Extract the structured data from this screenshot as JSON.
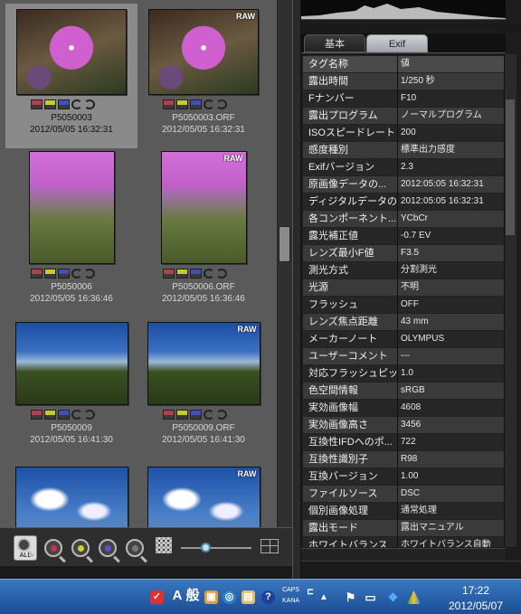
{
  "thumbnails": [
    {
      "name": "P5050003",
      "date": "2012/05/05 16:32:31",
      "raw": false,
      "selected": true,
      "art": "flower"
    },
    {
      "name": "P5050003.ORF",
      "date": "2012/05/05 16:32:31",
      "raw": true,
      "raw_label": "RAW",
      "selected": false,
      "art": "flower"
    },
    {
      "name": "P5050006",
      "date": "2012/05/05 16:36:46",
      "raw": false,
      "selected": false,
      "art": "meadow"
    },
    {
      "name": "P5050006.ORF",
      "date": "2012/05/05 16:36:46",
      "raw": true,
      "raw_label": "RAW",
      "selected": false,
      "art": "meadow"
    },
    {
      "name": "P5050009",
      "date": "2012/05/05 16:41:30",
      "raw": false,
      "selected": false,
      "art": "sky"
    },
    {
      "name": "P5050009.ORF",
      "date": "2012/05/05 16:41:30",
      "raw": true,
      "raw_label": "RAW",
      "selected": false,
      "art": "sky"
    },
    {
      "name": "",
      "date": "",
      "raw": false,
      "selected": false,
      "art": "cloud"
    },
    {
      "name": "",
      "date": "",
      "raw": true,
      "raw_label": "RAW",
      "selected": false,
      "art": "cloud"
    }
  ],
  "toolbar": {
    "zoom_all_label": "ALL"
  },
  "tabs": {
    "basic": "基本",
    "exif": "Exif"
  },
  "exif": {
    "header": {
      "key": "タグ名称",
      "value": "値"
    },
    "rows": [
      {
        "key": "露出時間",
        "value": "1/250 秒"
      },
      {
        "key": "Fナンバー",
        "value": "F10"
      },
      {
        "key": "露出プログラム",
        "value": "ノーマルプログラム"
      },
      {
        "key": "ISOスピードレート",
        "value": "200"
      },
      {
        "key": "感度種別",
        "value": "標準出力感度"
      },
      {
        "key": "Exifバージョン",
        "value": "2.3"
      },
      {
        "key": "原画像データの...",
        "value": "2012:05:05 16:32:31"
      },
      {
        "key": "ディジタルデータの...",
        "value": "2012:05:05 16:32:31"
      },
      {
        "key": "各コンポーネント...",
        "value": "YCbCr"
      },
      {
        "key": "露光補正値",
        "value": "-0.7 EV"
      },
      {
        "key": "レンズ最小F値",
        "value": "F3.5"
      },
      {
        "key": "測光方式",
        "value": "分割測光"
      },
      {
        "key": "光源",
        "value": "不明"
      },
      {
        "key": "フラッシュ",
        "value": "OFF"
      },
      {
        "key": "レンズ焦点距離",
        "value": "43 mm"
      },
      {
        "key": "メーカーノート",
        "value": "OLYMPUS"
      },
      {
        "key": "ユーザーコメント",
        "value": "---"
      },
      {
        "key": "対応フラッシュピッ...",
        "value": "1.0"
      },
      {
        "key": "色空間情報",
        "value": "sRGB"
      },
      {
        "key": "実効画像幅",
        "value": "4608"
      },
      {
        "key": "実効画像高さ",
        "value": "3456"
      },
      {
        "key": "互換性IFDへのポ...",
        "value": "722"
      },
      {
        "key": "互換性識別子",
        "value": "R98"
      },
      {
        "key": "互換バージョン",
        "value": "1.00"
      },
      {
        "key": "ファイルソース",
        "value": "DSC"
      },
      {
        "key": "個別画像処理",
        "value": "通常処理"
      },
      {
        "key": "露出モード",
        "value": "露出マニュアル"
      },
      {
        "key": "ホワイトバランス",
        "value": "ホワイトバランス自動"
      }
    ]
  },
  "taskbar": {
    "ime_a": "A",
    "ime_mode": "般",
    "caps": "CAPS",
    "kana": "KANA",
    "time": "17:22",
    "date": "2012/05/07"
  },
  "colors": {
    "accent_blue": "#1b4d94",
    "selected_cell": "#8a8a8a"
  }
}
